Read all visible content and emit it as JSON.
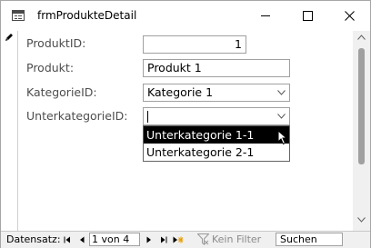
{
  "window": {
    "title": "frmProdukteDetail"
  },
  "fields": [
    {
      "label": "ProduktID:",
      "value": "1"
    },
    {
      "label": "Produkt:",
      "value": "Produkt 1"
    },
    {
      "label": "KategorieID:",
      "value": "Kategorie 1"
    },
    {
      "label": "UnterkategorieID:",
      "value": ""
    }
  ],
  "dropdown": {
    "options": [
      "Unterkategorie 1-1",
      "Unterkategorie 2-1"
    ],
    "selected_index": 0
  },
  "navigation": {
    "label": "Datensatz:",
    "position": "1 von 4",
    "filter_label": "Kein Filter",
    "search_placeholder": "Suchen"
  },
  "icons": {
    "app": "form-icon",
    "record": "pencil-icon",
    "combo": "chevron-down-icon"
  },
  "colors": {
    "selected_bg": "#000000",
    "selected_fg": "#ffffff",
    "label": "#4d4d4d"
  }
}
